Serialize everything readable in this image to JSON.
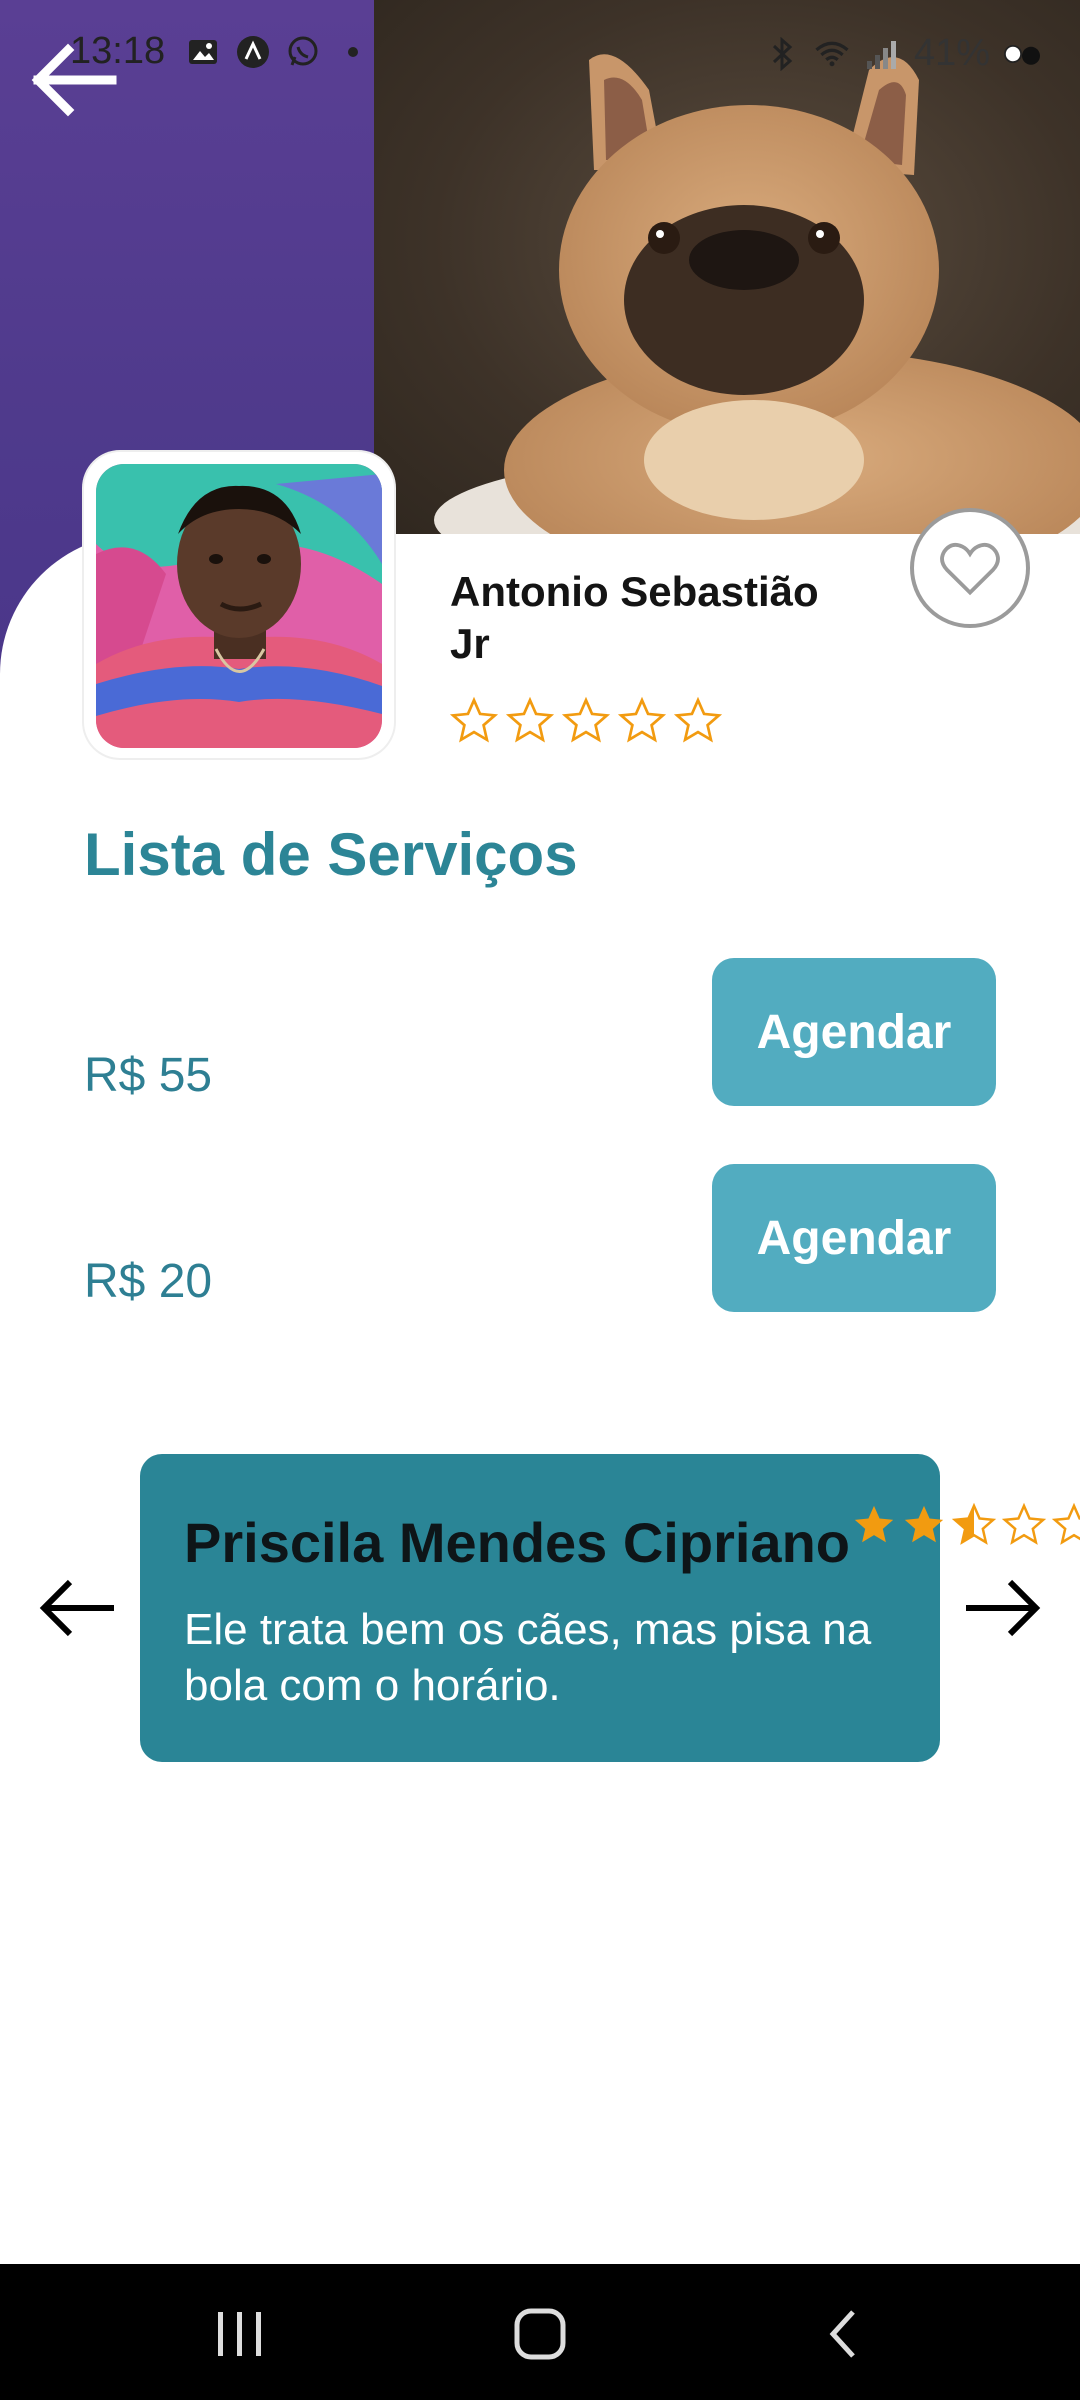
{
  "status_bar": {
    "time": "13:18",
    "battery": "41%",
    "icons_left": [
      "image-icon",
      "app-icon",
      "whatsapp-icon",
      "dot-icon"
    ],
    "icons_right": [
      "bluetooth-icon",
      "wifi-icon",
      "signal-icon",
      "battery-icon"
    ]
  },
  "provider": {
    "name": "Antonio Sebastião Jr",
    "rating_stars": 5,
    "rating_filled": 0
  },
  "services": {
    "title": "Lista de Serviços",
    "items": [
      {
        "price": "R$ 55",
        "button_label": "Agendar"
      },
      {
        "price": "R$ 20",
        "button_label": "Agendar"
      }
    ]
  },
  "review": {
    "author": "Priscila Mendes Cipriano",
    "text": "Ele trata bem os cães, mas pisa na bola com o horário.",
    "rating": 2.5,
    "stars_total": 5
  },
  "colors": {
    "accent": "#2c8596",
    "button": "#52acc0",
    "review_card": "#2a8596",
    "star": "#f29b10",
    "hero_purple": "#5a3f94"
  }
}
